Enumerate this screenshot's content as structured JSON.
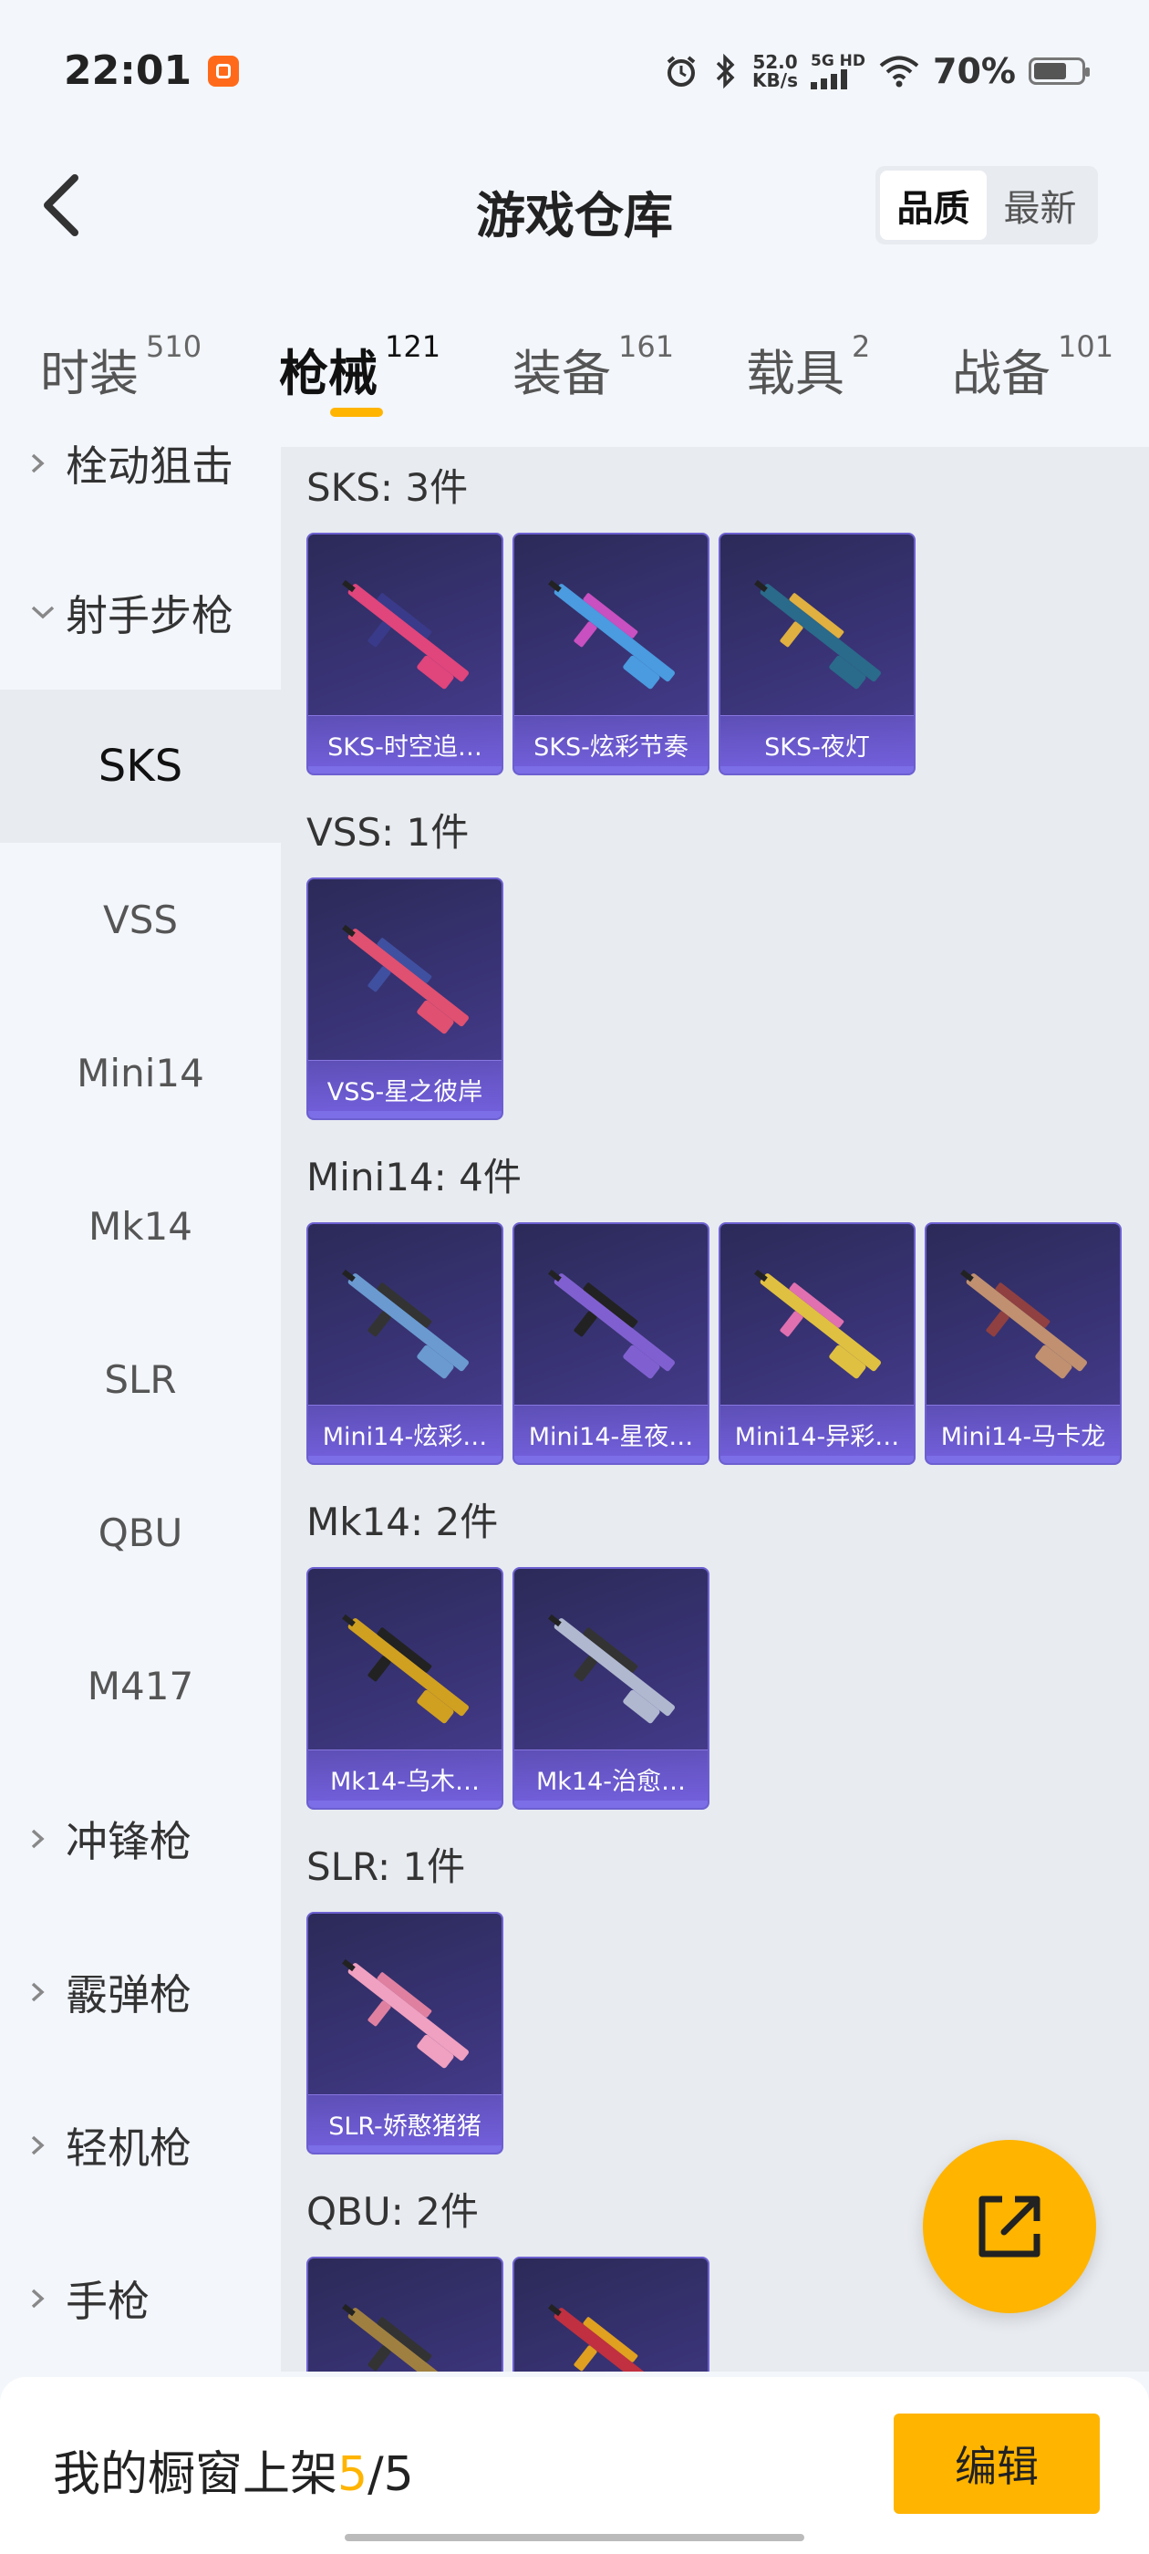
{
  "status_bar": {
    "time": "22:01",
    "net_speed_value": "52.0",
    "net_speed_unit": "KB/s",
    "net_type_top": "5G HD",
    "battery_percent": "70%",
    "battery_level": 0.7
  },
  "header": {
    "title": "游戏仓库",
    "sort_options": [
      "品质",
      "最新"
    ],
    "sort_selected": "品质"
  },
  "tabs": [
    {
      "label": "时装",
      "count": "510"
    },
    {
      "label": "枪械",
      "count": "121",
      "active": true
    },
    {
      "label": "装备",
      "count": "161"
    },
    {
      "label": "载具",
      "count": "2"
    },
    {
      "label": "战备",
      "count": "101"
    }
  ],
  "sidebar": {
    "items": [
      {
        "label": "栓动狙击",
        "type": "group",
        "expanded": false
      },
      {
        "label": "射手步枪",
        "type": "group",
        "expanded": true
      },
      {
        "label": "SKS",
        "type": "sub",
        "active": true
      },
      {
        "label": "VSS",
        "type": "sub"
      },
      {
        "label": "Mini14",
        "type": "sub"
      },
      {
        "label": "Mk14",
        "type": "sub"
      },
      {
        "label": "SLR",
        "type": "sub"
      },
      {
        "label": "QBU",
        "type": "sub"
      },
      {
        "label": "M417",
        "type": "sub"
      },
      {
        "label": "冲锋枪",
        "type": "group",
        "expanded": false
      },
      {
        "label": "霰弹枪",
        "type": "group",
        "expanded": false
      },
      {
        "label": "轻机枪",
        "type": "group",
        "expanded": false
      },
      {
        "label": "手枪",
        "type": "group",
        "expanded": false
      }
    ]
  },
  "sections": [
    {
      "title": "SKS: 3件",
      "items": [
        "SKS-时空追…",
        "SKS-炫彩节奏",
        "SKS-夜灯"
      ]
    },
    {
      "title": "VSS: 1件",
      "items": [
        "VSS-星之彼岸"
      ]
    },
    {
      "title": "Mini14: 4件",
      "items": [
        "Mini14-炫彩…",
        "Mini14-星夜…",
        "Mini14-异彩…",
        "Mini14-马卡龙"
      ]
    },
    {
      "title": "Mk14: 2件",
      "items": [
        "Mk14-乌木…",
        "Mk14-治愈…"
      ]
    },
    {
      "title": "SLR: 1件",
      "items": [
        "SLR-娇憨猪猪"
      ]
    },
    {
      "title": "QBU: 2件",
      "items": [
        "",
        ""
      ]
    }
  ],
  "bottom_bar": {
    "showcase_prefix": "我的橱窗上架",
    "showcase_current": "5",
    "showcase_sep": "/",
    "showcase_total": "5",
    "edit_label": "编辑"
  },
  "colors": {
    "accent": "#ffb400",
    "card_bg": "#3a3478",
    "card_border": "#6c5fd0"
  }
}
